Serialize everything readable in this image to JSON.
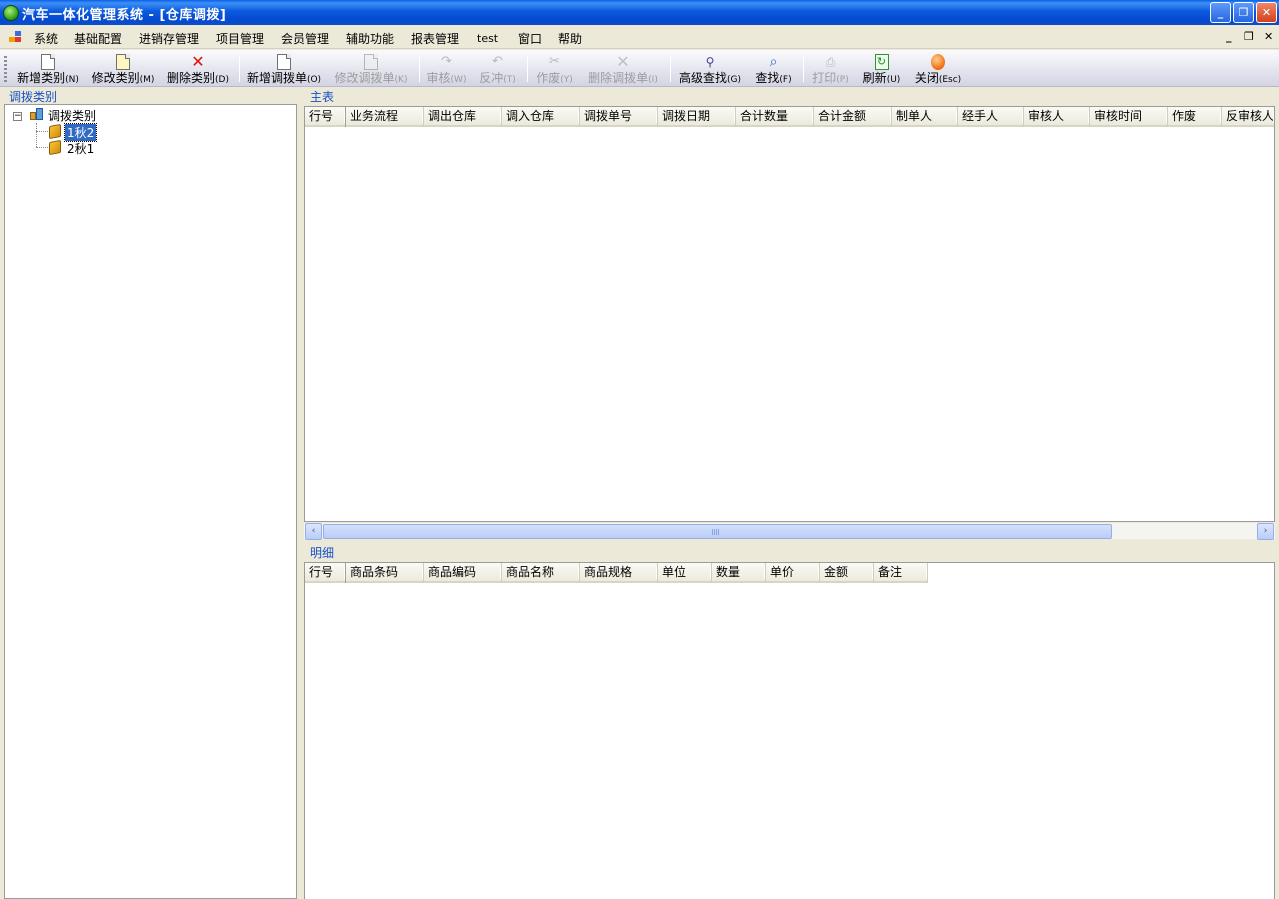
{
  "window": {
    "title": "汽车一体化管理系统 - [仓库调拨]",
    "controls": {
      "minimize": "_",
      "restore": "❐",
      "close": "✕"
    }
  },
  "menu": {
    "items": [
      "系统",
      "基础配置",
      "进销存管理",
      "项目管理",
      "会员管理",
      "辅助功能",
      "报表管理",
      "test",
      "窗口",
      "帮助"
    ],
    "mdi_controls": {
      "minimize": "_",
      "restore": "❐",
      "close": "✕"
    }
  },
  "toolbar": {
    "buttons": [
      {
        "label": "新增类别",
        "key": "(N)",
        "icon": "new-doc-icon",
        "enabled": true
      },
      {
        "label": "修改类别",
        "key": "(M)",
        "icon": "edit-doc-icon",
        "enabled": true
      },
      {
        "label": "删除类别",
        "key": "(D)",
        "icon": "delete-x-icon",
        "enabled": true
      },
      {
        "label": "新增调拨单",
        "key": "(O)",
        "icon": "new-doc-icon",
        "enabled": true
      },
      {
        "label": "修改调拨单",
        "key": "(K)",
        "icon": "edit-doc-icon",
        "enabled": false
      },
      {
        "label": "审核",
        "key": "(W)",
        "icon": "approve-icon",
        "enabled": false
      },
      {
        "label": "反冲",
        "key": "(T)",
        "icon": "reverse-icon",
        "enabled": false
      },
      {
        "label": "作废",
        "key": "(Y)",
        "icon": "void-icon",
        "enabled": false
      },
      {
        "label": "删除调拨单",
        "key": "(I)",
        "icon": "delete-x-icon",
        "enabled": false
      },
      {
        "label": "高级查找",
        "key": "(G)",
        "icon": "binoculars-icon",
        "enabled": true
      },
      {
        "label": "查找",
        "key": "(F)",
        "icon": "magnifier-icon",
        "enabled": true
      },
      {
        "label": "打印",
        "key": "(P)",
        "icon": "printer-icon",
        "enabled": false
      },
      {
        "label": "刷新",
        "key": "(U)",
        "icon": "refresh-icon",
        "enabled": true
      },
      {
        "label": "关闭",
        "key": "(Esc)",
        "icon": "close-circle-icon",
        "enabled": true
      }
    ]
  },
  "left_panel": {
    "title": "调拨类别",
    "tree": {
      "root": {
        "label": "调拨类别",
        "expander": "−"
      },
      "children": [
        {
          "label": "1秋2",
          "selected": true
        },
        {
          "label": "2秋1",
          "selected": false
        }
      ]
    }
  },
  "master_grid": {
    "title": "主表",
    "columns": [
      "行号",
      "业务流程",
      "调出仓库",
      "调入仓库",
      "调拨单号",
      "调拨日期",
      "合计数量",
      "合计金额",
      "制单人",
      "经手人",
      "审核人",
      "审核时间",
      "作废",
      "反审核人"
    ],
    "rows": [],
    "scroll": {
      "left": "‹",
      "right": "›"
    }
  },
  "detail_grid": {
    "title": "明细",
    "columns": [
      "行号",
      "商品条码",
      "商品编码",
      "商品名称",
      "商品规格",
      "单位",
      "数量",
      "单价",
      "金额",
      "备注"
    ],
    "rows": []
  },
  "colors": {
    "titlebar": "#0a5fe8",
    "selection": "#316ac5",
    "group_title": "#1650c8",
    "face": "#ece9d8"
  }
}
